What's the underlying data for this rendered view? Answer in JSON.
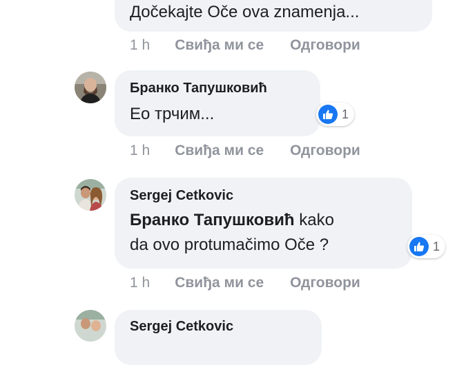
{
  "comments": [
    {
      "author": "",
      "text": "Дočekajte Oče ova znamenja...",
      "time": "1 h",
      "like_label": "Свиђа ми се",
      "reply_label": "Одговори"
    },
    {
      "author": "Бранко Тапушковић",
      "text": "Ео трчим...",
      "reaction_count": "1",
      "time": "1 h",
      "like_label": "Свиђа ми се",
      "reply_label": "Одговори"
    },
    {
      "author": "Sergej Cetkovic",
      "mention": "Бранко Тапушковић",
      "text_line1": " kako",
      "text_line2": "da ovo protumačimo Oče ?",
      "reaction_count": "1",
      "time": "1 h",
      "like_label": "Свиђа ми се",
      "reply_label": "Одговори"
    },
    {
      "author": "Sergej Cetkovic"
    }
  ],
  "colors": {
    "bubble": "#f0f2f5",
    "meta_text": "#90949c",
    "like_blue": "#1877f2"
  }
}
